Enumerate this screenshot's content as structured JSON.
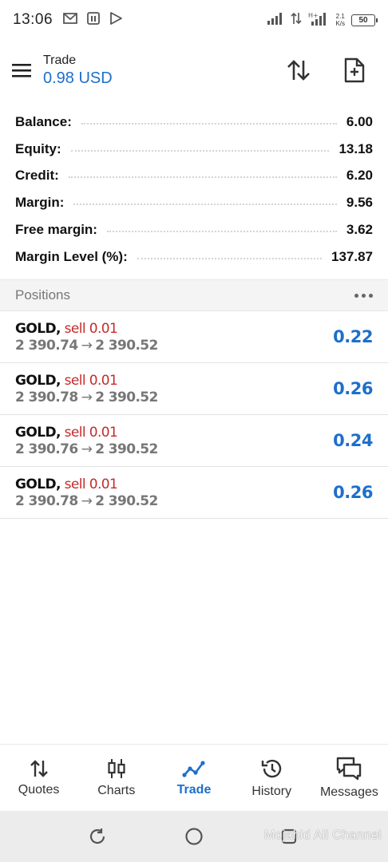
{
  "status_bar": {
    "time": "13:06",
    "net_speed_top": "2.1",
    "net_speed_bottom": "K/s",
    "battery": "50",
    "left_icons": [
      "gmail-icon",
      "sim-card-icon",
      "play-store-icon"
    ],
    "right_icons": [
      "signal-icon",
      "data-arrows-icon",
      "hplus-signal-icon"
    ]
  },
  "toolbar": {
    "title": "Trade",
    "subtitle": "0.98 USD",
    "actions": [
      "sort-icon",
      "new-order-icon"
    ]
  },
  "summary": {
    "rows": [
      {
        "label": "Balance:",
        "value": "6.00"
      },
      {
        "label": "Equity:",
        "value": "13.18"
      },
      {
        "label": "Credit:",
        "value": "6.20"
      },
      {
        "label": "Margin:",
        "value": "9.56"
      },
      {
        "label": "Free margin:",
        "value": "3.62"
      },
      {
        "label": "Margin Level (%):",
        "value": "137.87"
      }
    ]
  },
  "positions": {
    "title": "Positions",
    "items": [
      {
        "symbol": "GOLD,",
        "type": "sell 0.01",
        "open_price": "2 390.74",
        "arrow": "→",
        "current_price": "2 390.52",
        "profit": "0.22"
      },
      {
        "symbol": "GOLD,",
        "type": "sell 0.01",
        "open_price": "2 390.78",
        "arrow": "→",
        "current_price": "2 390.52",
        "profit": "0.26"
      },
      {
        "symbol": "GOLD,",
        "type": "sell 0.01",
        "open_price": "2 390.76",
        "arrow": "→",
        "current_price": "2 390.52",
        "profit": "0.24"
      },
      {
        "symbol": "GOLD,",
        "type": "sell 0.01",
        "open_price": "2 390.78",
        "arrow": "→",
        "current_price": "2 390.52",
        "profit": "0.26"
      }
    ]
  },
  "bottom_nav": {
    "items": [
      {
        "label": "Quotes",
        "icon": "quotes-icon",
        "active": false
      },
      {
        "label": "Charts",
        "icon": "charts-icon",
        "active": false
      },
      {
        "label": "Trade",
        "icon": "trade-icon",
        "active": true
      },
      {
        "label": "History",
        "icon": "history-icon",
        "active": false
      },
      {
        "label": "Messages",
        "icon": "messages-icon",
        "active": false
      }
    ]
  },
  "system_nav": {
    "watermark": "Mojahid Ali Channel"
  },
  "colors": {
    "accent": "#1d6fcb",
    "sell": "#c62a2a",
    "muted": "#777777"
  }
}
